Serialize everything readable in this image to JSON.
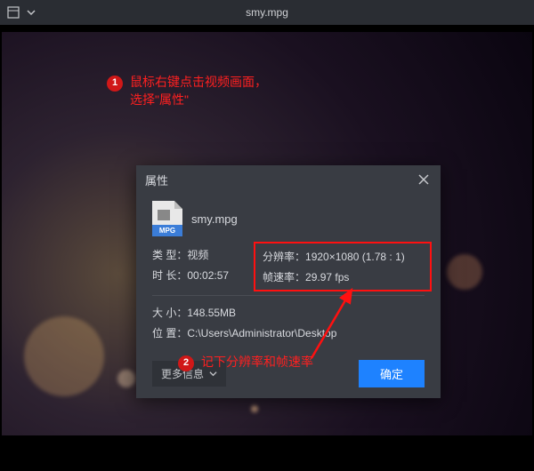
{
  "titlebar": {
    "filename": "smy.mpg"
  },
  "annotations": {
    "step1_num": "1",
    "step1_text": "鼠标右键点击视频画面，\n选择\"属性\"",
    "step2_num": "2",
    "step2_text": "记下分辨率和帧速率"
  },
  "dialog": {
    "title": "属性",
    "file_badge": "MPG",
    "filename": "smy.mpg",
    "type_label": "类 型：",
    "type_value": "视频",
    "duration_label": "时 长：",
    "duration_value": "00:02:57",
    "resolution_label": "分辨率：",
    "resolution_value": "1920×1080 (1.78 : 1)",
    "fps_label": "帧速率：",
    "fps_value": "29.97 fps",
    "size_label": "大 小：",
    "size_value": "148.55MB",
    "location_label": "位 置：",
    "location_value": "C:\\Users\\Administrator\\Desktop",
    "more_info": "更多信息",
    "ok": "确定"
  }
}
